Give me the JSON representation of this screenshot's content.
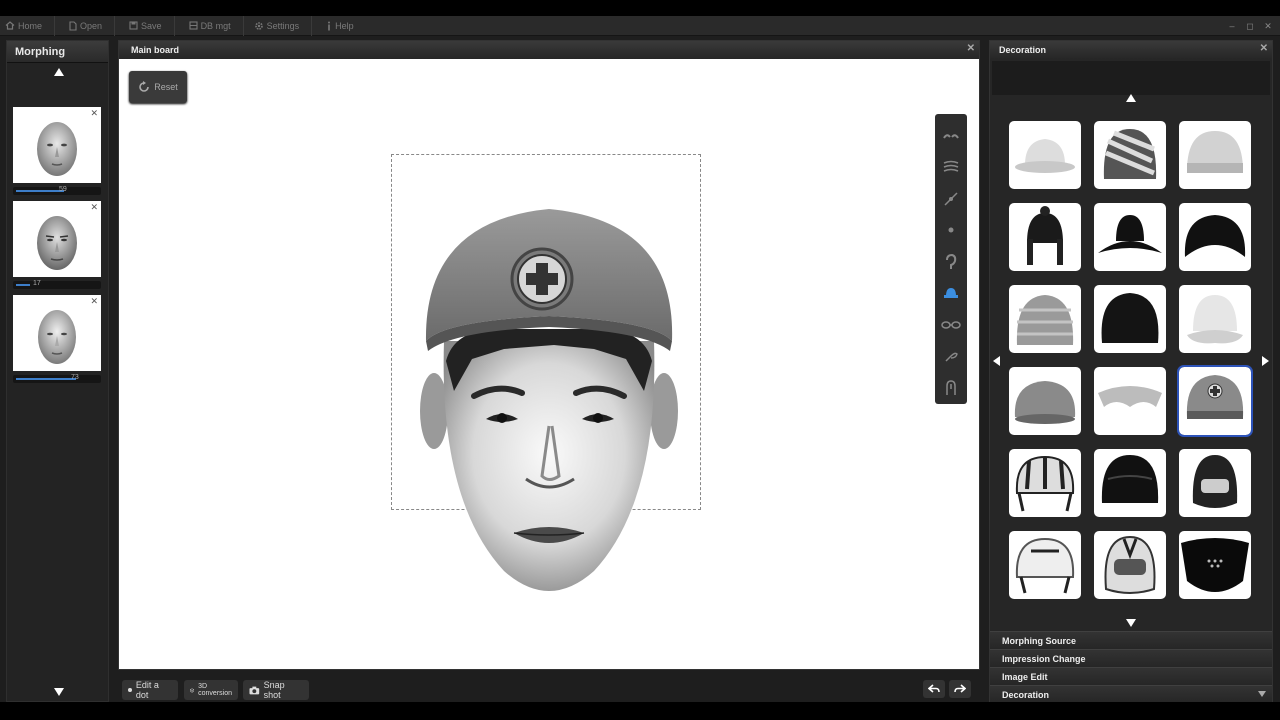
{
  "menu": [
    {
      "label": "Home",
      "icon": "home-icon"
    },
    {
      "label": "Open",
      "icon": "open-file-icon"
    },
    {
      "label": "Save",
      "icon": "save-icon"
    },
    {
      "label": "DB mgt",
      "icon": "database-icon"
    },
    {
      "label": "Settings",
      "icon": "gear-icon"
    },
    {
      "label": "Help",
      "icon": "info-icon"
    }
  ],
  "left_panel": {
    "title": "Morphing",
    "thumbnails": [
      {
        "value": "59",
        "level": 0.59
      },
      {
        "value": "17",
        "level": 0.17
      },
      {
        "value": "73",
        "level": 0.73
      }
    ]
  },
  "main": {
    "title": "Main board",
    "reset_label": "Reset",
    "tools": [
      "eyebrow-tool-icon",
      "hair-tool-icon",
      "nose-line-tool-icon",
      "mole-tool-icon",
      "ear-tool-icon",
      "hat-tool-icon",
      "glasses-tool-icon",
      "mustache-tool-icon",
      "clothing-tool-icon"
    ],
    "bottom": {
      "edit_dot": "Edit a dot",
      "conv_top": "3D",
      "conv_bottom": "conversion",
      "snapshot": "Snap shot"
    }
  },
  "right_panel": {
    "title": "Decoration",
    "items": [
      "white-bucket-hat",
      "striped-beanie",
      "knit-cap",
      "black-earflap-hat",
      "black-brimmed-hat",
      "black-bucket-hat",
      "knit-winter-hat",
      "fur-hat",
      "white-cloche-hat",
      "baseball-cap",
      "visor",
      "red-cross-helmet",
      "bicycle-helmet",
      "black-motorcycle-helmet",
      "full-face-helmet",
      "white-helmet",
      "racing-helmet",
      "face-mask"
    ],
    "selected_index": 11,
    "sections": [
      "Morphing Source",
      "Impression Change",
      "Image Edit",
      "Decoration"
    ]
  }
}
